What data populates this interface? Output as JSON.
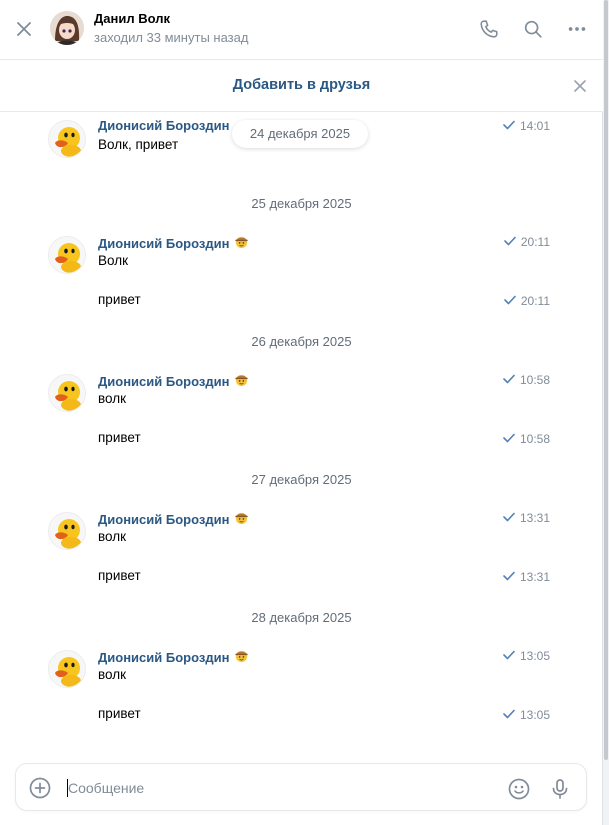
{
  "header": {
    "name": "Данил Волк",
    "status": "заходил 33 минуты назад"
  },
  "friend_bar": {
    "add_label": "Добавить в друзья"
  },
  "floating_date": "24 декабря 2025",
  "author": "Дионисий Бороздин",
  "messages": [
    {
      "text": "Волк, привет",
      "time": "14:01"
    },
    {
      "date": "25 декабря 2025"
    },
    {
      "text": "Волк",
      "time": "20:11"
    },
    {
      "text": "привет",
      "time": "20:11"
    },
    {
      "date": "26 декабря 2025"
    },
    {
      "text": "волк",
      "time": "10:58"
    },
    {
      "text": "привет",
      "time": "10:58"
    },
    {
      "date": "27 декабря 2025"
    },
    {
      "text": "волк",
      "time": "13:31"
    },
    {
      "text": "привет",
      "time": "13:31"
    },
    {
      "date": "28 декабря 2025"
    },
    {
      "text": "волк",
      "time": "13:05"
    },
    {
      "text": "привет",
      "time": "13:05"
    }
  ],
  "composer": {
    "placeholder": "Сообщение"
  },
  "colors": {
    "link": "#2a5885",
    "muted": "#818c99",
    "check": "#5181b8"
  }
}
